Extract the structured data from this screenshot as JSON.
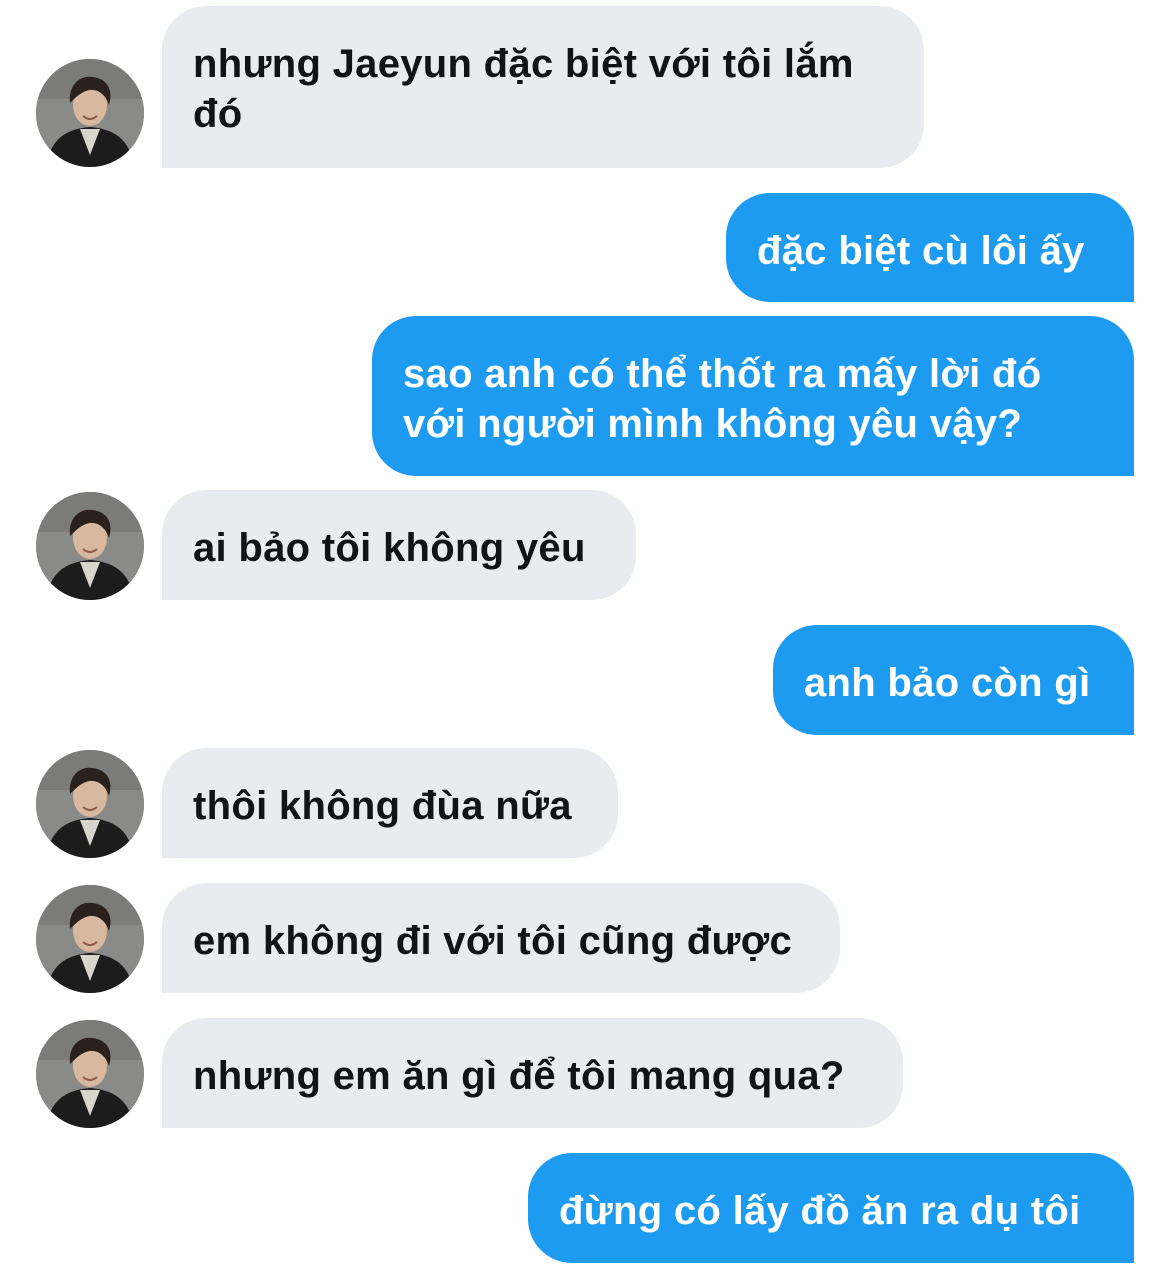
{
  "conversation": {
    "messages": [
      {
        "sender": "contact",
        "text": "nhưng Jaeyun đặc biệt với tôi lắm đó",
        "avatar": "profile-photo-icon"
      },
      {
        "sender": "me",
        "text": "đặc biệt cù lôi ấy"
      },
      {
        "sender": "me",
        "text": "sao anh có thể thốt ra mấy lời đó với người mình không yêu vậy?"
      },
      {
        "sender": "contact",
        "text": "ai bảo tôi không yêu",
        "avatar": "profile-photo-icon"
      },
      {
        "sender": "me",
        "text": "anh bảo còn gì"
      },
      {
        "sender": "contact",
        "text": "thôi không đùa nữa",
        "avatar": "profile-photo-icon"
      },
      {
        "sender": "contact",
        "text": "em không đi với tôi cũng được",
        "avatar": "profile-photo-icon"
      },
      {
        "sender": "contact",
        "text": "nhưng em ăn gì để tôi mang qua?",
        "avatar": "profile-photo-icon"
      },
      {
        "sender": "me",
        "text": "đừng có lấy đồ ăn ra dụ tôi"
      }
    ]
  },
  "colors": {
    "incoming_bubble": "#e8ecf0",
    "incoming_text": "#0f1419",
    "outgoing_bubble": "#1d9bf0",
    "outgoing_text": "#ffffff"
  }
}
